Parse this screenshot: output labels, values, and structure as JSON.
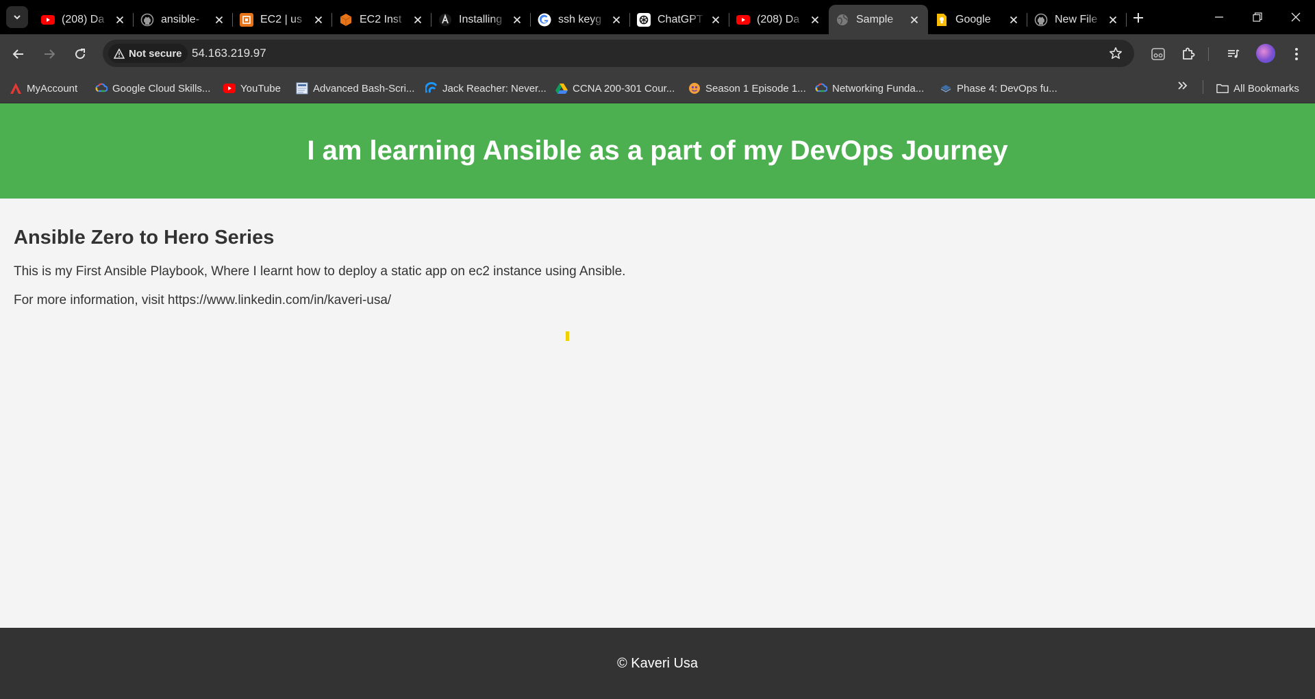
{
  "browser": {
    "tabs": [
      {
        "title": "(208) Da",
        "favicon": "youtube-icon",
        "color": "#ff0000",
        "active": false
      },
      {
        "title": "ansible-",
        "favicon": "github-icon",
        "color": "#2b2b2b",
        "active": false
      },
      {
        "title": "EC2 | us",
        "favicon": "aws-ec2-icon",
        "color": "#e8741a",
        "active": false
      },
      {
        "title": "EC2 Inst",
        "favicon": "aws-instance-icon",
        "color": "#e8741a",
        "active": false
      },
      {
        "title": "Installing",
        "favicon": "ansible-icon",
        "color": "#1a1a1a",
        "active": false
      },
      {
        "title": "ssh keyg",
        "favicon": "google-icon",
        "color": "#ffffff",
        "active": false
      },
      {
        "title": "ChatGPT",
        "favicon": "chatgpt-icon",
        "color": "#ffffff",
        "active": false
      },
      {
        "title": "(208) Da",
        "favicon": "youtube-icon",
        "color": "#ff0000",
        "active": false
      },
      {
        "title": "Sample",
        "favicon": "globe-icon",
        "color": "#5f6368",
        "active": true
      },
      {
        "title": "Google",
        "favicon": "google-keep-icon",
        "color": "#fbbc04",
        "active": false
      },
      {
        "title": "New File",
        "favicon": "github-icon",
        "color": "#2b2b2b",
        "active": false
      }
    ],
    "security_label": "Not secure",
    "url": "54.163.219.97",
    "bookmarks": [
      {
        "label": "MyAccount",
        "icon": "myaccount-icon"
      },
      {
        "label": "Google Cloud Skills...",
        "icon": "google-cloud-icon"
      },
      {
        "label": "YouTube",
        "icon": "youtube-icon"
      },
      {
        "label": "Advanced Bash-Scri...",
        "icon": "document-icon"
      },
      {
        "label": "Jack Reacher: Never...",
        "icon": "prime-video-icon"
      },
      {
        "label": "CCNA 200-301 Cour...",
        "icon": "google-drive-icon"
      },
      {
        "label": "Season 1 Episode 1...",
        "icon": "episode-icon"
      },
      {
        "label": "Networking Funda...",
        "icon": "google-cloud-icon"
      },
      {
        "label": "Phase 4: DevOps fu...",
        "icon": "devops-icon"
      }
    ],
    "all_bookmarks_label": "All Bookmarks"
  },
  "page": {
    "header_title": "I am learning Ansible as a part of my DevOps Journey",
    "section_title": "Ansible Zero to Hero Series",
    "paragraph_1": "This is my First Ansible Playbook, Where I learnt how to deploy a static app on ec2 instance using Ansible.",
    "paragraph_2": "For more information, visit https://www.linkedin.com/in/kaveri-usa/",
    "footer_text": "© Kaveri Usa",
    "colors": {
      "header_bg": "#4caf50",
      "footer_bg": "#333333",
      "page_bg": "#f4f4f4"
    }
  }
}
